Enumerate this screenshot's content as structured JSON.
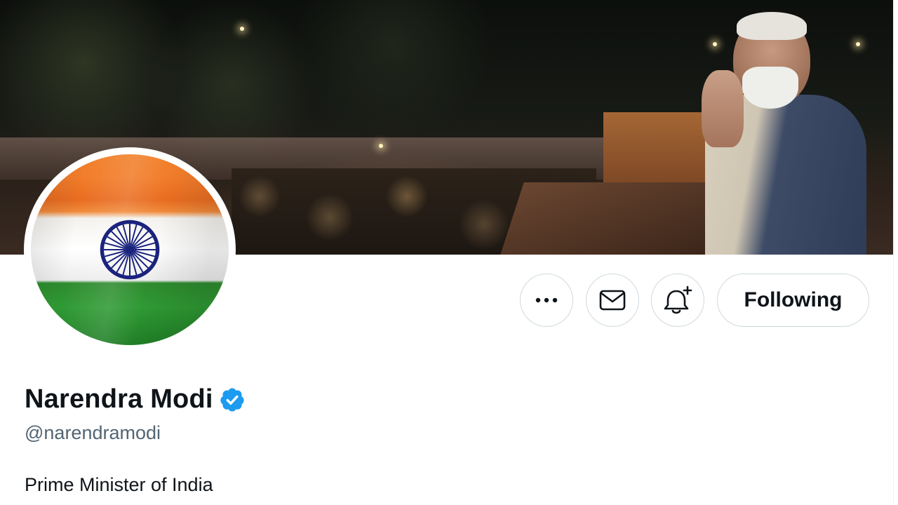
{
  "profile": {
    "name": "Narendra Modi",
    "handle": "@narendramodi",
    "bio": "Prime Minister of India",
    "verified": true
  },
  "actions": {
    "more_icon": "more-dots-icon",
    "message_icon": "envelope-icon",
    "notify_icon": "bell-plus-icon",
    "follow_label": "Following"
  },
  "colors": {
    "verified_badge": "#1d9bf0",
    "text_primary": "#0f1419",
    "text_secondary": "#536471",
    "button_border": "#cfd9de"
  }
}
